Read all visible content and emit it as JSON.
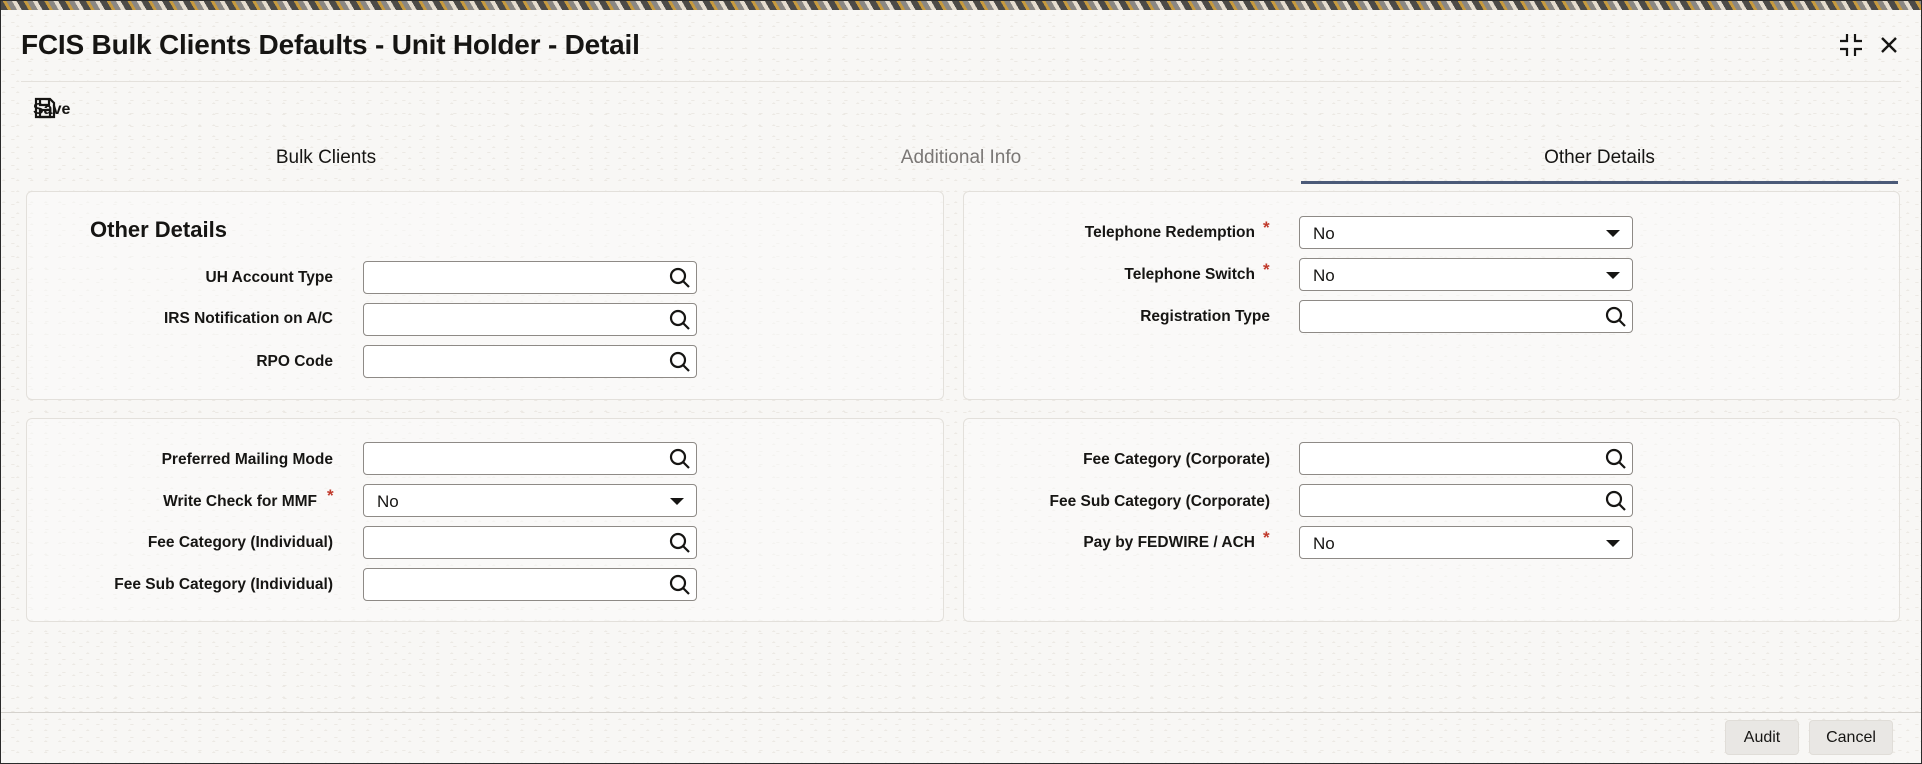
{
  "window": {
    "title": "FCIS Bulk Clients Defaults - Unit Holder - Detail"
  },
  "toolbar": {
    "save_label": "Save"
  },
  "tabs": [
    {
      "label": "Bulk Clients",
      "state": "default"
    },
    {
      "label": "Additional Info",
      "state": "inactive"
    },
    {
      "label": "Other Details",
      "state": "active"
    }
  ],
  "section": {
    "title": "Other Details"
  },
  "fields": {
    "uh_account_type": {
      "label": "UH Account Type",
      "value": ""
    },
    "irs_notification": {
      "label": "IRS Notification on A/C",
      "value": ""
    },
    "rpo_code": {
      "label": "RPO Code",
      "value": ""
    },
    "telephone_redemption": {
      "label": "Telephone Redemption",
      "value": "No",
      "required": true
    },
    "telephone_switch": {
      "label": "Telephone Switch",
      "value": "No",
      "required": true
    },
    "registration_type": {
      "label": "Registration Type",
      "value": ""
    },
    "preferred_mailing_mode": {
      "label": "Preferred Mailing Mode",
      "value": ""
    },
    "write_check_mmf": {
      "label": "Write Check for MMF",
      "value": "No",
      "required": true
    },
    "fee_category_individual": {
      "label": "Fee Category (Individual)",
      "value": ""
    },
    "fee_sub_category_individual": {
      "label": "Fee Sub Category (Individual)",
      "value": ""
    },
    "fee_category_corporate": {
      "label": "Fee Category (Corporate)",
      "value": ""
    },
    "fee_sub_category_corporate": {
      "label": "Fee Sub Category (Corporate)",
      "value": ""
    },
    "pay_by_fedwire": {
      "label": "Pay by FEDWIRE / ACH",
      "value": "No",
      "required": true
    }
  },
  "required_marker": "*",
  "footer": {
    "audit_label": "Audit",
    "cancel_label": "Cancel"
  },
  "colors": {
    "tab_active_underline": "#4b5a78",
    "required": "#c0392b",
    "text": "#161513"
  }
}
